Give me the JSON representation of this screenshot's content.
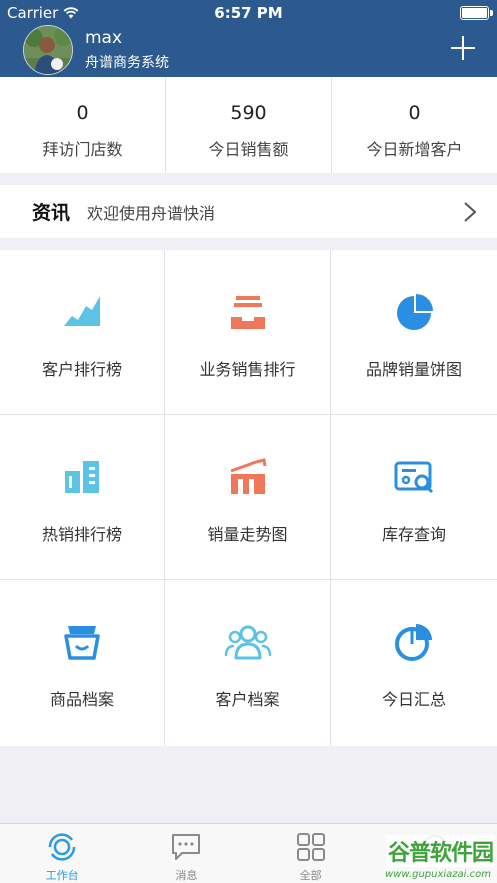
{
  "status_bar": {
    "carrier": "Carrier",
    "time": "6:57 PM"
  },
  "header": {
    "user_name": "max",
    "company": "舟谱商务系统"
  },
  "stats": [
    {
      "value": "0",
      "label": "拜访门店数"
    },
    {
      "value": "590",
      "label": "今日销售额"
    },
    {
      "value": "0",
      "label": "今日新增客户"
    }
  ],
  "news": {
    "title": "资讯",
    "text": "欢迎使用舟谱快消"
  },
  "grid": [
    {
      "label": "客户排行榜",
      "icon": "area-chart-icon",
      "color": "#5bc3e4"
    },
    {
      "label": "业务销售排行",
      "icon": "inbox-stack-icon",
      "color": "#f0785a"
    },
    {
      "label": "品牌销量饼图",
      "icon": "pie-chart-icon",
      "color": "#2a8fe0"
    },
    {
      "label": "热销排行榜",
      "icon": "buildings-icon",
      "color": "#5bc3e4"
    },
    {
      "label": "销量走势图",
      "icon": "bar-trend-icon",
      "color": "#f0785a"
    },
    {
      "label": "库存查询",
      "icon": "inventory-search-icon",
      "color": "#2a8fe0"
    },
    {
      "label": "商品档案",
      "icon": "basket-icon",
      "color": "#2a8fe0"
    },
    {
      "label": "客户档案",
      "icon": "users-icon",
      "color": "#5bc3e4"
    },
    {
      "label": "今日汇总",
      "icon": "summary-pie-icon",
      "color": "#2a8fe0"
    }
  ],
  "tabbar": [
    {
      "label": "工作台",
      "icon": "workbench-icon",
      "active": true
    },
    {
      "label": "消息",
      "icon": "message-icon",
      "active": false
    },
    {
      "label": "全部",
      "icon": "grid-icon",
      "active": false
    },
    {
      "label": "",
      "icon": "more-icon",
      "active": false
    }
  ],
  "watermark": {
    "main": "谷普软件园",
    "url": "www.gupuxiazai.com"
  },
  "colors": {
    "header_bg": "#2d5a8e",
    "accent": "#2a9be0"
  }
}
